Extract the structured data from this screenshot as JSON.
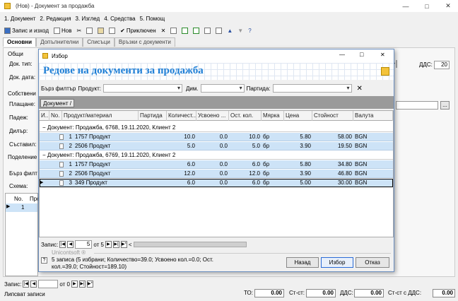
{
  "window": {
    "title": "(Нов) - Документ за продажба"
  },
  "menu": [
    "1. Документ",
    "2. Редакция",
    "3. Изглед",
    "4. Средства",
    "5. Помощ"
  ],
  "toolbar": {
    "save_close": "Запис и изход",
    "new": "Нов",
    "close_doc": "Приключен"
  },
  "tabs": [
    "Основни",
    "Допълнителни",
    "Списъци",
    "Връзки с документи"
  ],
  "form": {
    "general": "Общи",
    "doc_type": "Док. тип:",
    "doc_date": "Док. дата:",
    "own": "Собствени",
    "payment": "Плащане:",
    "pade": "Падеж:",
    "dealer": "Дилър:",
    "creator": "Съставил:",
    "division": "Поделение",
    "vat_label": "ДДС:",
    "vat_value": "20",
    "quick_filter": "Бърз филт",
    "scheme": "Схема:",
    "col_no": "No.",
    "col_pro": "Про",
    "row_no": "1"
  },
  "dialog": {
    "title": "Избор",
    "header": "Редове на документи за продажба",
    "quick_filter": "Бърз филтър",
    "product": "Продукт:",
    "dim": "Дим.",
    "batch": "Партида:",
    "group_button": "Документ",
    "columns": [
      "И...",
      "No.",
      "Продукт/материал",
      "Партида",
      "Количест...",
      "Усвоено ...",
      "Ост. кол.",
      "Мярка",
      "Цена",
      "Стойност",
      "Валута"
    ],
    "groups": [
      {
        "label": "Документ: Продажба, 6768, 19.11.2020, Клиент 2",
        "rows": [
          {
            "no": "1",
            "product": "1757 Продукт",
            "qty": "10.0",
            "used": "0.0",
            "rest": "10.0",
            "unit": "бр",
            "price": "5.80",
            "value": "58.00",
            "cur": "BGN"
          },
          {
            "no": "2",
            "product": "2506 Продукт",
            "qty": "5.0",
            "used": "0.0",
            "rest": "5.0",
            "unit": "бр",
            "price": "3.90",
            "value": "19.50",
            "cur": "BGN"
          }
        ]
      },
      {
        "label": "Документ: Продажба, 6769, 19.11.2020, Клиент 2",
        "rows": [
          {
            "no": "1",
            "product": "1757 Продукт",
            "qty": "6.0",
            "used": "0.0",
            "rest": "6.0",
            "unit": "бр",
            "price": "5.80",
            "value": "34.80",
            "cur": "BGN"
          },
          {
            "no": "2",
            "product": "2506 Продукт",
            "qty": "12.0",
            "used": "0.0",
            "rest": "12.0",
            "unit": "бр",
            "price": "3.90",
            "value": "46.80",
            "cur": "BGN"
          },
          {
            "no": "3",
            "product": "349 Продукт",
            "qty": "6.0",
            "used": "0.0",
            "rest": "6.0",
            "unit": "бр",
            "price": "5.00",
            "value": "30.00",
            "cur": "BGN"
          }
        ]
      }
    ],
    "nav_label": "Запис:",
    "nav_current": "5",
    "nav_of": "от 5",
    "brand": "Unicontsoft ®",
    "summary": "5 записа (5 избрани; Количество=39.0; Усвоено кол.=0.0; Ост. кол.=39.0; Стойност=189.10)",
    "back": "Назад",
    "select": "Избор",
    "cancel": "Отказ"
  },
  "bottom": {
    "nav_label": "Запис:",
    "nav_of": "от 0",
    "status": "Липсват записи",
    "to": "ТО:",
    "to_value": "0.00",
    "stst": "Ст-ст:",
    "stst_value": "0.00",
    "vat": "ДДС:",
    "vat_value": "0.00",
    "st_vat": "Ст-ст с ДДС:",
    "st_vat_value": "0.00"
  },
  "colors": {
    "selection": "#cde3f7",
    "header_text": "#1f7fd6",
    "group_panel": "#9a9a9a"
  }
}
